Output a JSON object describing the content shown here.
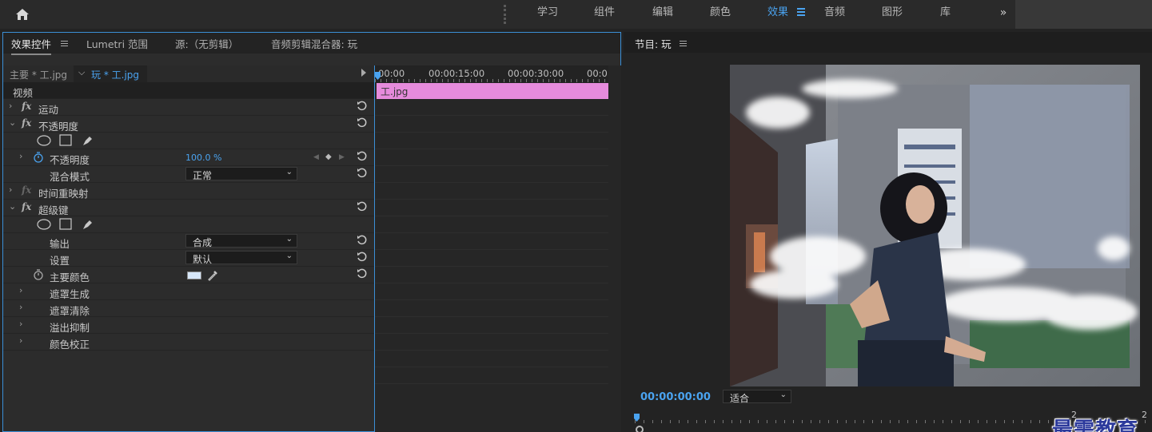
{
  "topbar": {
    "nav": [
      {
        "label": "学习",
        "active": false
      },
      {
        "label": "组件",
        "active": false
      },
      {
        "label": "编辑",
        "active": false
      },
      {
        "label": "颜色",
        "active": false
      },
      {
        "label": "效果",
        "active": true
      },
      {
        "label": "音频",
        "active": false
      },
      {
        "label": "图形",
        "active": false
      },
      {
        "label": "库",
        "active": false
      }
    ],
    "more_glyph": "»"
  },
  "left_panel": {
    "tabs": [
      {
        "label": "效果控件",
        "active": true
      },
      {
        "label": "Lumetri 范围",
        "active": false
      },
      {
        "label": "源:（无剪辑）",
        "active": false
      },
      {
        "label": "音频剪辑混合器: 玩",
        "active": false
      }
    ],
    "clip_header": {
      "master": "主要 * 工.jpg",
      "sequence": "玩 * 工.jpg"
    },
    "section_video": "视频",
    "rows": {
      "motion": "运动",
      "opacity": "不透明度",
      "opacity_prop": "不透明度",
      "opacity_value": "100.0 %",
      "blend_mode": "混合模式",
      "blend_mode_value": "正常",
      "time_remap": "时间重映射",
      "ultra_key": "超级键",
      "output": "输出",
      "output_value": "合成",
      "setting": "设置",
      "setting_value": "默认",
      "key_color": "主要颜色",
      "key_color_swatch": "#d6e6f8",
      "matte_gen": "遮罩生成",
      "matte_clean": "遮罩清除",
      "spill": "溢出抑制",
      "color_correct": "颜色校正"
    },
    "timeline": {
      "timecodes": [
        "00:00",
        "00:00:15:00",
        "00:00:30:00",
        "00:0"
      ],
      "clip_label": "工.jpg",
      "clip_color": "#e68bdc"
    }
  },
  "right_panel": {
    "tab": "节目: 玩",
    "timecode": "00:00:00:00",
    "fit": "适合",
    "ruler_zero": "2",
    "ruler_zero2": "2",
    "watermark": "最需教育"
  }
}
